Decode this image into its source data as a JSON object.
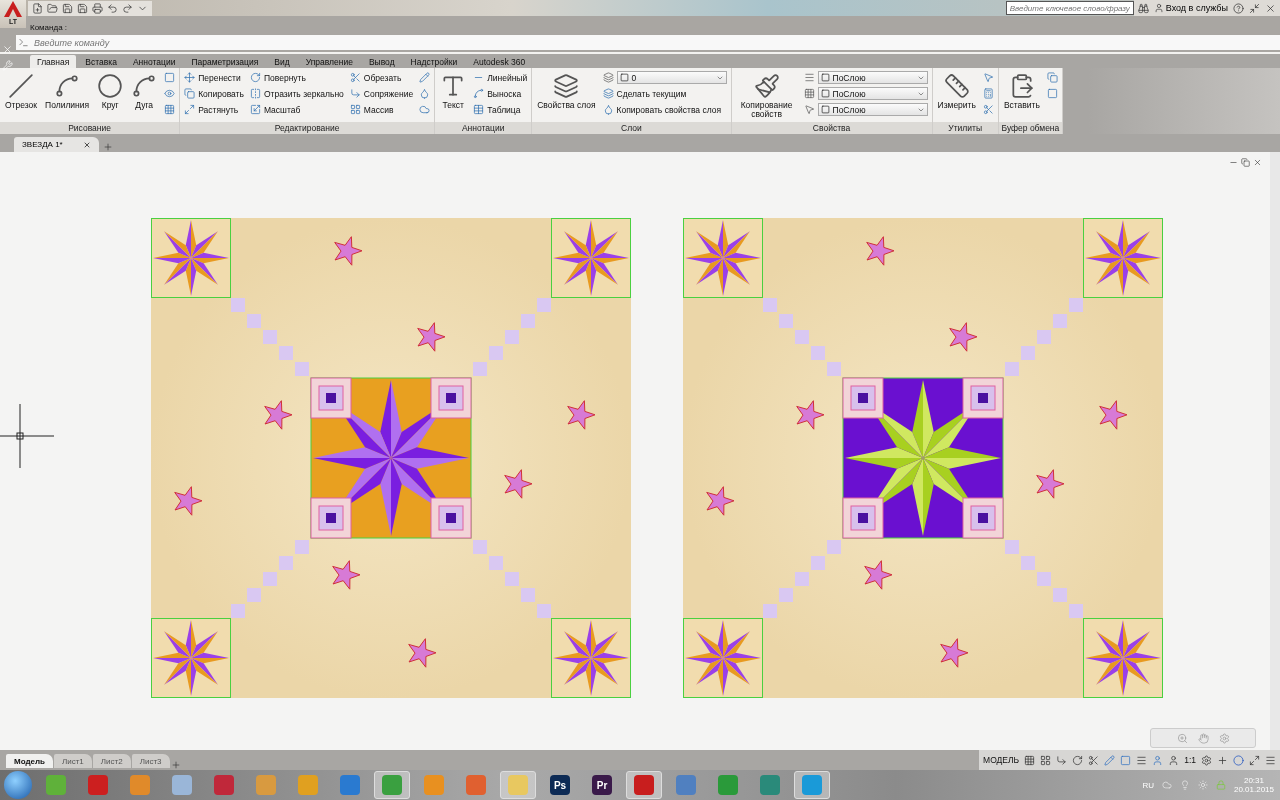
{
  "title_bar": {
    "search": {
      "placeholder": "Введите ключевое слово/фразу"
    },
    "sign_in": "Вход в службы",
    "logo_badge": "LT"
  },
  "command_line": {
    "label": "Команда :",
    "placeholder": "Введите команду"
  },
  "ribbon_tabs": [
    {
      "label": "Главная",
      "selected": true
    },
    {
      "label": "Вставка",
      "selected": false
    },
    {
      "label": "Аннотации",
      "selected": false
    },
    {
      "label": "Параметризация",
      "selected": false
    },
    {
      "label": "Вид",
      "selected": false
    },
    {
      "label": "Управление",
      "selected": false
    },
    {
      "label": "Вывод",
      "selected": false
    },
    {
      "label": "Надстройки",
      "selected": false
    },
    {
      "label": "Autodesk 360",
      "selected": false
    }
  ],
  "panels": [
    {
      "title": "Рисование",
      "items": [
        {
          "kind": "large",
          "label": "Отрезок"
        },
        {
          "kind": "large",
          "label": "Полилиния"
        },
        {
          "kind": "large",
          "label": "Круг"
        },
        {
          "kind": "large",
          "label": "Дуга"
        },
        {
          "kind": "column",
          "items": [
            {
              "kind": "icon"
            },
            {
              "kind": "icon"
            },
            {
              "kind": "icon"
            }
          ]
        }
      ]
    },
    {
      "title": "Редактирование",
      "items": [
        {
          "kind": "column",
          "items": [
            {
              "kind": "small",
              "label": "Перенести"
            },
            {
              "kind": "small",
              "label": "Копировать"
            },
            {
              "kind": "small",
              "label": "Растянуть"
            }
          ]
        },
        {
          "kind": "column",
          "items": [
            {
              "kind": "small",
              "label": "Повернуть"
            },
            {
              "kind": "small",
              "label": "Отразить зеркально"
            },
            {
              "kind": "small",
              "label": "Масштаб"
            }
          ]
        },
        {
          "kind": "column",
          "items": [
            {
              "kind": "small",
              "label": "Обрезать"
            },
            {
              "kind": "small",
              "label": "Сопряжение"
            },
            {
              "kind": "small",
              "label": "Массив"
            }
          ]
        },
        {
          "kind": "column",
          "items": [
            {
              "kind": "icon"
            },
            {
              "kind": "icon"
            },
            {
              "kind": "icon"
            }
          ]
        }
      ]
    },
    {
      "title": "Аннотации",
      "items": [
        {
          "kind": "large",
          "label": "Текст"
        },
        {
          "kind": "column",
          "items": [
            {
              "kind": "small",
              "label": "Линейный"
            },
            {
              "kind": "small",
              "label": "Выноска"
            },
            {
              "kind": "small",
              "label": "Таблица"
            }
          ]
        }
      ]
    },
    {
      "title": "Слои",
      "items": [
        {
          "kind": "large",
          "label": "Свойства слоя"
        },
        {
          "kind": "column",
          "items": [
            {
              "kind": "dropdown",
              "value": "0"
            },
            {
              "kind": "small",
              "label": "Сделать текущим"
            },
            {
              "kind": "small",
              "label": "Копировать свойства слоя"
            }
          ]
        }
      ]
    },
    {
      "title": "Свойства",
      "items": [
        {
          "kind": "large",
          "label": "Копирование свойств"
        },
        {
          "kind": "column",
          "items": [
            {
              "kind": "dropdown",
              "value": "ПоСлою"
            },
            {
              "kind": "dropdown",
              "value": "ПоСлою"
            },
            {
              "kind": "dropdown",
              "value": "ПоСлою"
            }
          ]
        }
      ]
    },
    {
      "title": "Утилиты",
      "items": [
        {
          "kind": "large",
          "label": "Измерить"
        },
        {
          "kind": "column",
          "items": [
            {
              "kind": "icon"
            },
            {
              "kind": "icon"
            },
            {
              "kind": "icon"
            }
          ]
        }
      ]
    },
    {
      "title": "Буфер обмена",
      "items": [
        {
          "kind": "large",
          "label": "Вставить"
        },
        {
          "kind": "column",
          "items": [
            {
              "kind": "icon"
            },
            {
              "kind": "icon"
            }
          ]
        }
      ]
    }
  ],
  "document_tabs": [
    {
      "label": "ЗВЕЗДА 1*",
      "selected": true
    }
  ],
  "quilts": [
    {
      "kind": "amber"
    },
    {
      "kind": "lime"
    }
  ],
  "layout_tabs": [
    {
      "label": "Модель",
      "selected": true
    },
    {
      "label": "Лист1",
      "selected": false
    },
    {
      "label": "Лист2",
      "selected": false
    },
    {
      "label": "Лист3",
      "selected": false
    }
  ],
  "status_bar": {
    "space": "МОДЕЛЬ",
    "scale": "1:1"
  },
  "taskbar": {
    "apps": [
      {
        "color": "#5fb13a",
        "active": false
      },
      {
        "color": "#cc1f1f",
        "active": false
      },
      {
        "color": "#e08a2a",
        "active": false
      },
      {
        "color": "#9ab6d8",
        "active": false
      },
      {
        "color": "#c0283a",
        "active": false
      },
      {
        "color": "#d89a40",
        "active": false
      },
      {
        "color": "#e0a020",
        "active": false
      },
      {
        "color": "#2a7ad0",
        "active": false
      },
      {
        "color": "#3aa040",
        "active": true
      },
      {
        "color": "#e89020",
        "active": false
      },
      {
        "color": "#e06030",
        "active": false
      },
      {
        "color": "#e8c860",
        "active": true
      },
      {
        "color": "#0c2a55",
        "active": false,
        "label": "Ps"
      },
      {
        "color": "#3a1a4a",
        "active": false,
        "label": "Pr"
      },
      {
        "color": "#c81e1e",
        "active": true
      },
      {
        "color": "#5080c0",
        "active": false
      },
      {
        "color": "#2a9a3a",
        "active": false
      },
      {
        "color": "#2a8a7a",
        "active": false
      },
      {
        "color": "#1a9ad8",
        "active": true
      }
    ],
    "language": "RU",
    "time": "20:31",
    "date": "20.01.2015"
  }
}
